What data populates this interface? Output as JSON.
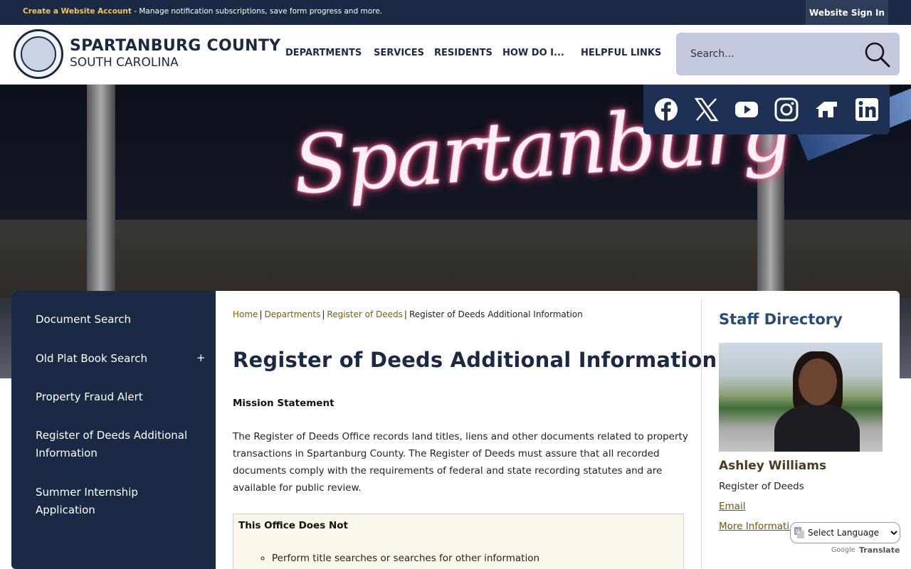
{
  "topbar": {
    "create_account": "Create a Website Account",
    "promo_text": " - Manage notification subscriptions, save form progress and more.",
    "signin": "Website Sign In"
  },
  "logo": {
    "title": "SPARTANBURG COUNTY",
    "subtitle": "SOUTH CAROLINA"
  },
  "nav": {
    "items": [
      "DEPARTMENTS",
      "SERVICES",
      "RESIDENTS",
      "HOW DO I...",
      "HELPFUL LINKS"
    ]
  },
  "search": {
    "placeholder": "Search..."
  },
  "hero": {
    "sign_text": "Spartanburg"
  },
  "social": {
    "icons": [
      "facebook-icon",
      "x-icon",
      "youtube-icon",
      "instagram-icon",
      "nextdoor-icon",
      "linkedin-icon"
    ]
  },
  "sidebar": {
    "items": [
      {
        "label": "Document Search"
      },
      {
        "label": "Old Plat Book Search",
        "expand": "+"
      },
      {
        "label": "Property Fraud Alert"
      },
      {
        "label": "Register of Deeds Additional Information"
      },
      {
        "label": "Summer Internship Application"
      }
    ]
  },
  "breadcrumb": {
    "home": "Home",
    "departments": "Departments",
    "register": "Register of Deeds",
    "current": "Register of Deeds Additional Information"
  },
  "page": {
    "title": "Register of Deeds Additional Information",
    "mission_heading": "Mission Statement",
    "mission_text": "The Register of Deeds Office records land titles, liens and other documents related to property transactions in Spartanburg County. The Register of Deeds must assure that all recorded documents comply with the requirements of federal and state recording statutes and are available for public review.",
    "not_heading": "This Office Does Not",
    "not_items": [
      "Perform title searches or searches for other information"
    ]
  },
  "staff": {
    "heading": "Staff Directory",
    "name": "Ashley Williams",
    "role": "Register of Deeds",
    "email": "Email",
    "more": "More Information"
  },
  "translate": {
    "select_label": "Select Language",
    "powered": "Google",
    "translate": "Translate"
  },
  "colors": {
    "navy": "#1b2a44",
    "accent_gold": "#f3c45a",
    "link_brown": "#8a5a00",
    "staff_heading": "#2a4b74"
  }
}
